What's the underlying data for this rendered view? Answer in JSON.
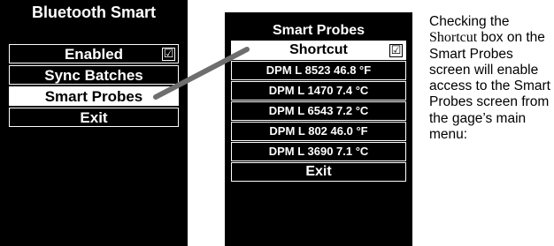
{
  "left_screen": {
    "title": "Bluetooth Smart",
    "menu": [
      {
        "label": "Enabled",
        "checkbox": "☑",
        "selected": false
      },
      {
        "label": "Sync Batches",
        "selected": false
      },
      {
        "label": "Smart Probes",
        "selected": true
      },
      {
        "label": "Exit",
        "selected": false
      }
    ]
  },
  "right_screen": {
    "title": "Smart Probes",
    "shortcut": {
      "label": "Shortcut",
      "checkbox": "☑",
      "selected": true
    },
    "probes": [
      "DPM L 8523 46.8 °F",
      "DPM L 1470 7.4 °C",
      "DPM L 6543 7.2 °C",
      "DPM L 802 46.0 °F",
      "DPM L 3690 7.1 °C"
    ],
    "exit_label": "Exit"
  },
  "caption": {
    "part1": "Checking the",
    "shortcut_word": "Shortcut",
    "part2": "box on the Smart Probes screen will enable access to the Smart Probes screen from the gage’s main menu:"
  }
}
